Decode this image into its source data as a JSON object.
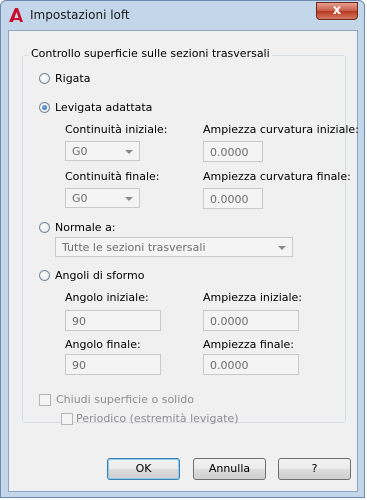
{
  "window": {
    "title": "Impostazioni loft",
    "close_glyph": "x"
  },
  "group": {
    "title": "Controllo superficie sulle sezioni trasversali"
  },
  "ruled": {
    "label": "Rigata",
    "checked": false
  },
  "smooth": {
    "label": "Levigata adattata",
    "checked": true,
    "start_continuity_label": "Continuità iniziale:",
    "start_continuity_value": "G0",
    "start_bulge_label": "Ampiezza curvatura iniziale:",
    "start_bulge_value": "0.0000",
    "end_continuity_label": "Continuità finale:",
    "end_continuity_value": "G0",
    "end_bulge_label": "Ampiezza curvatura finale:",
    "end_bulge_value": "0.0000"
  },
  "normal": {
    "label": "Normale a:",
    "checked": false,
    "value": "Tutte le sezioni trasversali"
  },
  "draft": {
    "label": "Angoli di sformo",
    "checked": false,
    "start_angle_label": "Angolo iniziale:",
    "start_angle_value": "90",
    "start_magnitude_label": "Ampiezza iniziale:",
    "start_magnitude_value": "0.0000",
    "end_angle_label": "Angolo finale:",
    "end_angle_value": "90",
    "end_magnitude_label": "Ampiezza finale:",
    "end_magnitude_value": "0.0000"
  },
  "close_surface": {
    "label": "Chiudi superficie o solido",
    "checked": false
  },
  "periodic": {
    "label": "Periodico (estremità levigate)",
    "checked": false
  },
  "buttons": {
    "ok": "OK",
    "cancel": "Annulla",
    "help": "?"
  },
  "colors": {
    "titlebar": "#c3d6ea",
    "close": "#c75a45",
    "accent_red": "#c8102e"
  }
}
